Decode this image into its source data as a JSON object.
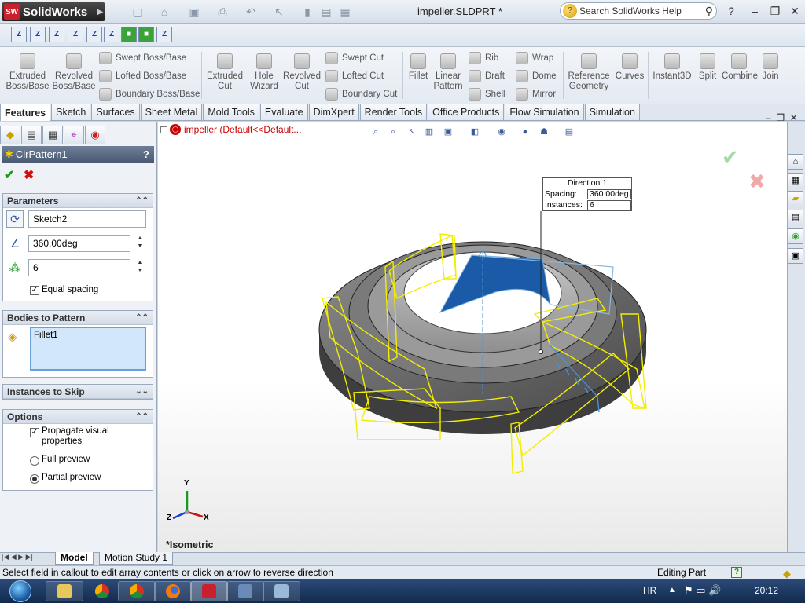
{
  "app": {
    "name": "SolidWorks",
    "document_title": "impeller.SLDPRT *",
    "search_placeholder": "Search SolidWorks Help"
  },
  "command_manager": {
    "extruded_boss": "Extruded Boss/Base",
    "revolved_boss": "Revolved Boss/Base",
    "swept_boss": "Swept Boss/Base",
    "lofted_boss": "Lofted Boss/Base",
    "boundary_boss": "Boundary Boss/Base",
    "extruded_cut": "Extruded Cut",
    "hole_wizard": "Hole Wizard",
    "revolved_cut": "Revolved Cut",
    "swept_cut": "Swept Cut",
    "lofted_cut": "Lofted Cut",
    "boundary_cut": "Boundary Cut",
    "fillet": "Fillet",
    "linear_pattern": "Linear Pattern",
    "rib": "Rib",
    "draft": "Draft",
    "shell": "Shell",
    "wrap": "Wrap",
    "dome": "Dome",
    "mirror": "Mirror",
    "reference_geometry": "Reference Geometry",
    "curves": "Curves",
    "instant3d": "Instant3D",
    "split": "Split",
    "combine": "Combine",
    "join": "Join"
  },
  "tabs": [
    "Features",
    "Sketch",
    "Surfaces",
    "Sheet Metal",
    "Mold Tools",
    "Evaluate",
    "DimXpert",
    "Render Tools",
    "Office Products",
    "Flow Simulation",
    "Simulation"
  ],
  "property_manager": {
    "title": "CirPattern1",
    "help": "?",
    "parameters": {
      "header": "Parameters",
      "axis": "Sketch2",
      "angle": "360.00deg",
      "instances": "6",
      "equal_spacing": "Equal spacing"
    },
    "bodies": {
      "header": "Bodies to Pattern",
      "item": "Fillet1"
    },
    "skip": {
      "header": "Instances to Skip"
    },
    "options": {
      "header": "Options",
      "propagate": "Propagate visual properties",
      "full_preview": "Full preview",
      "partial_preview": "Partial preview"
    }
  },
  "viewport": {
    "tree_item": "impeller  (Default<<Default...",
    "callout": {
      "title": "Direction 1",
      "spacing_label": "Spacing:",
      "spacing_value": "360.00deg",
      "instances_label": "Instances:",
      "instances_value": "6"
    },
    "view_label": "*Isometric",
    "triad": {
      "x": "X",
      "y": "Y",
      "z": "Z"
    }
  },
  "bottom_tabs": [
    "Model",
    "Motion Study 1"
  ],
  "status": {
    "message": "Select field in callout to edit array contents or click on arrow to reverse direction",
    "mode": "Editing Part",
    "help": "?"
  },
  "taskbar": {
    "lang": "HR",
    "time": "20:12"
  },
  "colors": {
    "preview": "#f2ee00",
    "selection": "#1b5aa6",
    "part": "#5e5e5e"
  }
}
